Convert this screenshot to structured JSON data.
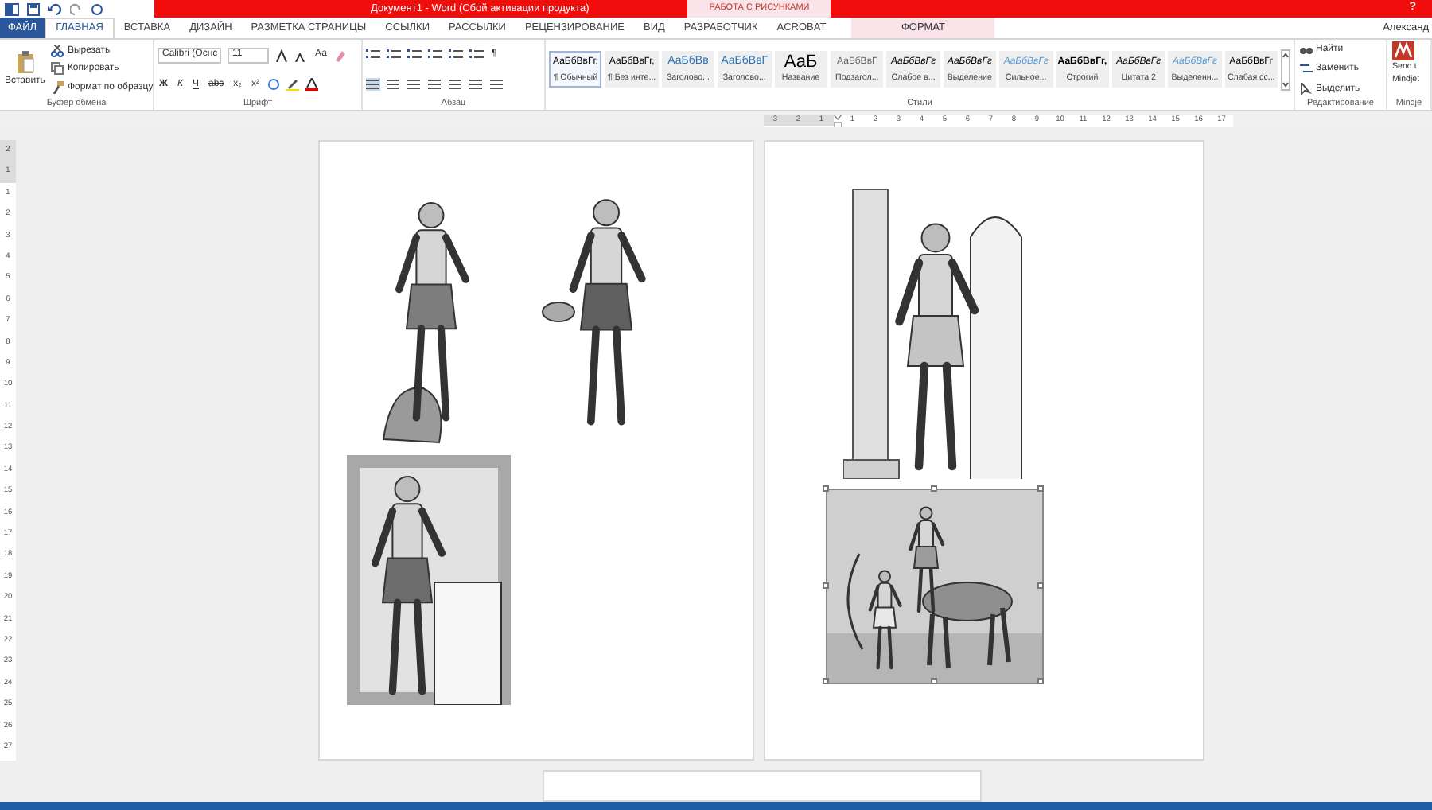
{
  "window": {
    "title": "Документ1 - Word (Сбой активации продукта)",
    "context_header": "РАБОТА С РИСУНКАМИ",
    "help": "?",
    "user": "Александ"
  },
  "tabs": [
    {
      "label": "ФАЙЛ",
      "kind": "file",
      "selected": false
    },
    {
      "label": "ГЛАВНАЯ",
      "kind": "tab",
      "selected": true
    },
    {
      "label": "ВСТАВКА",
      "kind": "tab",
      "selected": false
    },
    {
      "label": "ДИЗАЙН",
      "kind": "tab",
      "selected": false
    },
    {
      "label": "РАЗМЕТКА СТРАНИЦЫ",
      "kind": "tab",
      "selected": false
    },
    {
      "label": "ССЫЛКИ",
      "kind": "tab",
      "selected": false
    },
    {
      "label": "РАССЫЛКИ",
      "kind": "tab",
      "selected": false
    },
    {
      "label": "РЕЦЕНЗИРОВАНИЕ",
      "kind": "tab",
      "selected": false
    },
    {
      "label": "ВИД",
      "kind": "tab",
      "selected": false
    },
    {
      "label": "РАЗРАБОТЧИК",
      "kind": "tab",
      "selected": false
    },
    {
      "label": "ACROBAT",
      "kind": "tab",
      "selected": false
    },
    {
      "label": "ФОРМАТ",
      "kind": "context",
      "selected": false
    }
  ],
  "ribbon": {
    "clipboard": {
      "paste": "Вставить",
      "items": [
        "Вырезать",
        "Копировать",
        "Формат по образцу"
      ],
      "label": "Буфер обмена"
    },
    "font": {
      "name": "Calibri (Оснс",
      "size": "11",
      "format_buttons": [
        "Ж",
        "К",
        "Ч",
        "abc",
        "x₂",
        "x²"
      ],
      "case": "Аа",
      "label": "Шрифт"
    },
    "paragraph": {
      "pilcrow": "¶",
      "label": "Абзац"
    },
    "styles": {
      "label": "Стили",
      "items": [
        {
          "preview": "АаБбВвГг,",
          "name": "¶ Обычный",
          "kind": "plain",
          "selected": true
        },
        {
          "preview": "АаБбВвГг,",
          "name": "¶ Без инте...",
          "kind": "plain",
          "selected": false
        },
        {
          "preview": "АаБбВв",
          "name": "Заголово...",
          "kind": "heading",
          "selected": false
        },
        {
          "preview": "АаБбВвГ",
          "name": "Заголово...",
          "kind": "heading",
          "selected": false
        },
        {
          "preview": "АаБ",
          "name": "Название",
          "kind": "title",
          "selected": false
        },
        {
          "preview": "АаБбВвГ",
          "name": "Подзагол...",
          "kind": "subtle",
          "selected": false
        },
        {
          "preview": "АаБбВвГг",
          "name": "Слабое в...",
          "kind": "emphasis",
          "selected": false
        },
        {
          "preview": "АаБбВвГг",
          "name": "Выделение",
          "kind": "emphasis",
          "selected": false
        },
        {
          "preview": "АаБбВвГг",
          "name": "Сильное...",
          "kind": "intense",
          "selected": false
        },
        {
          "preview": "АаБбВвГг,",
          "name": "Строгий",
          "kind": "strong",
          "selected": false
        },
        {
          "preview": "АаБбВвГг",
          "name": "Цитата 2",
          "kind": "emphasis",
          "selected": false
        },
        {
          "preview": "АаБбВвГг",
          "name": "Выделенн...",
          "kind": "intense",
          "selected": false
        },
        {
          "preview": "АаБбВвГг",
          "name": "Слабая сс...",
          "kind": "plain",
          "selected": false
        }
      ]
    },
    "editing": {
      "items": [
        "Найти",
        "Заменить",
        "Выделить"
      ],
      "label": "Редактирование"
    },
    "mindjet": {
      "lines": [
        "Send t",
        "Mindjet"
      ],
      "label": "Mindje"
    }
  },
  "ruler": {
    "horizontal": [
      "3",
      "2",
      "1",
      "1",
      "2",
      "3",
      "4",
      "5",
      "6",
      "7",
      "8",
      "9",
      "10",
      "11",
      "12",
      "13",
      "14",
      "15",
      "16",
      "17"
    ],
    "vertical": [
      "2",
      "1",
      "1",
      "2",
      "3",
      "4",
      "5",
      "6",
      "7",
      "8",
      "9",
      "10",
      "11",
      "12",
      "13",
      "14",
      "15",
      "16",
      "17",
      "18",
      "19",
      "20",
      "21",
      "22",
      "23",
      "24",
      "25",
      "26",
      "27"
    ]
  },
  "pages": [
    {
      "pictures": [
        {
          "selected": false
        },
        {
          "selected": false
        }
      ]
    },
    {
      "pictures": [
        {
          "selected": false
        },
        {
          "selected": true
        }
      ]
    }
  ]
}
